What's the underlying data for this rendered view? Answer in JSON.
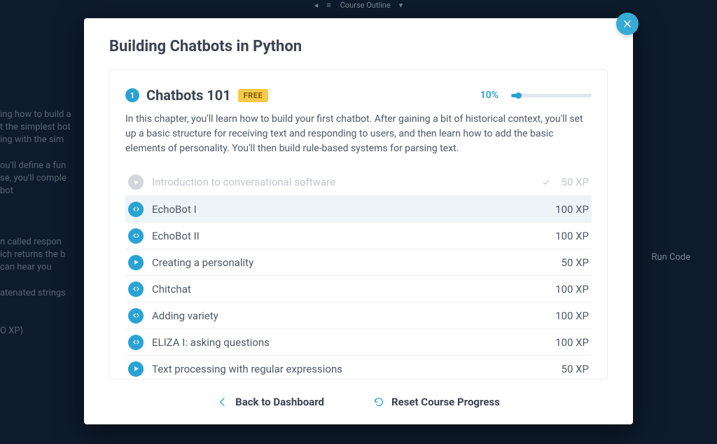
{
  "topbar": {
    "label": "Course Outline"
  },
  "background": {
    "left_blurb": "ing how to build a\nt the simplest bot\ning with the sim\n\nou'll define a fun\nse, you'll comple\nbot\n\n\n\nn called  respon\nich returns the b\n can hear you\n\natenated strings\n\n\nO XP)",
    "right_blurb": "Run Code"
  },
  "modal": {
    "title": "Building Chatbots in Python",
    "close_aria": "Close"
  },
  "chapter": {
    "number": "1",
    "title": "Chatbots 101",
    "badge": "FREE",
    "progress_pct": "10%",
    "description": "In this chapter, you'll learn how to build your first chatbot. After gaining a bit of historical context, you'll set up a basic structure for receiving text and responding to users, and then learn how to add the basic elements of personality. You'll then build rule-based systems for parsing text."
  },
  "lessons": [
    {
      "name": "Introduction to conversational software",
      "xp": "50 XP",
      "type": "video",
      "completed": true
    },
    {
      "name": "EchoBot I",
      "xp": "100 XP",
      "type": "code",
      "active": true
    },
    {
      "name": "EchoBot II",
      "xp": "100 XP",
      "type": "code"
    },
    {
      "name": "Creating a personality",
      "xp": "50 XP",
      "type": "video"
    },
    {
      "name": "Chitchat",
      "xp": "100 XP",
      "type": "code"
    },
    {
      "name": "Adding variety",
      "xp": "100 XP",
      "type": "code"
    },
    {
      "name": "ELIZA I: asking questions",
      "xp": "100 XP",
      "type": "code"
    },
    {
      "name": "Text processing with regular expressions",
      "xp": "50 XP",
      "type": "video"
    }
  ],
  "footer": {
    "back": "Back to Dashboard",
    "reset": "Reset Course Progress"
  },
  "colors": {
    "accent": "#2aa3d4",
    "badge_bg": "#f7c948"
  }
}
